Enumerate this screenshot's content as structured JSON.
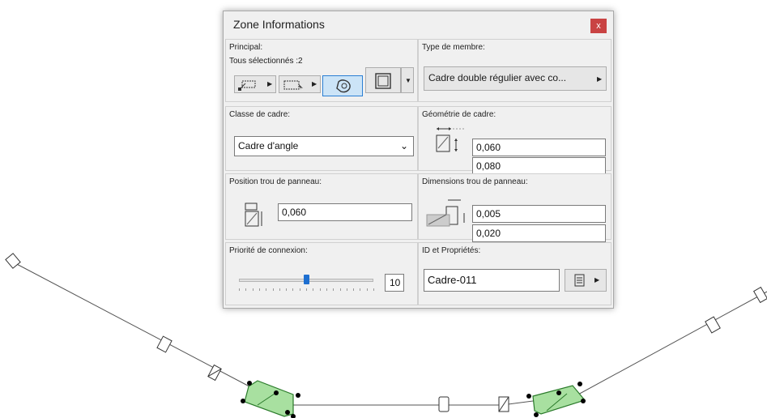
{
  "dialog": {
    "title": "Zone Informations",
    "close_label": "x"
  },
  "principal": {
    "label": "Principal:",
    "selection_text": "Tous sélectionnés :2"
  },
  "member_type": {
    "label": "Type de membre:",
    "value": "Cadre double régulier avec co..."
  },
  "frame_class": {
    "label": "Classe de cadre:",
    "value": "Cadre d'angle"
  },
  "frame_geometry": {
    "label": "Géométrie de cadre:",
    "width": "0,060",
    "depth": "0,080"
  },
  "panel_hole_position": {
    "label": "Position trou de panneau:",
    "value": "0,060"
  },
  "panel_hole_dimensions": {
    "label": "Dimensions trou de panneau:",
    "value1": "0,005",
    "value2": "0,020"
  },
  "connection_priority": {
    "label": "Priorité de connexion:",
    "value": "10",
    "slider_fraction": 0.5
  },
  "id_properties": {
    "label": "ID et Propriétés:",
    "id_value": "Cadre-011"
  },
  "colors": {
    "close_red": "#c94343",
    "selection_blue": "#cce4f7",
    "frame_green": "#a8e0a0",
    "slider_thumb": "#1e6fd0"
  }
}
